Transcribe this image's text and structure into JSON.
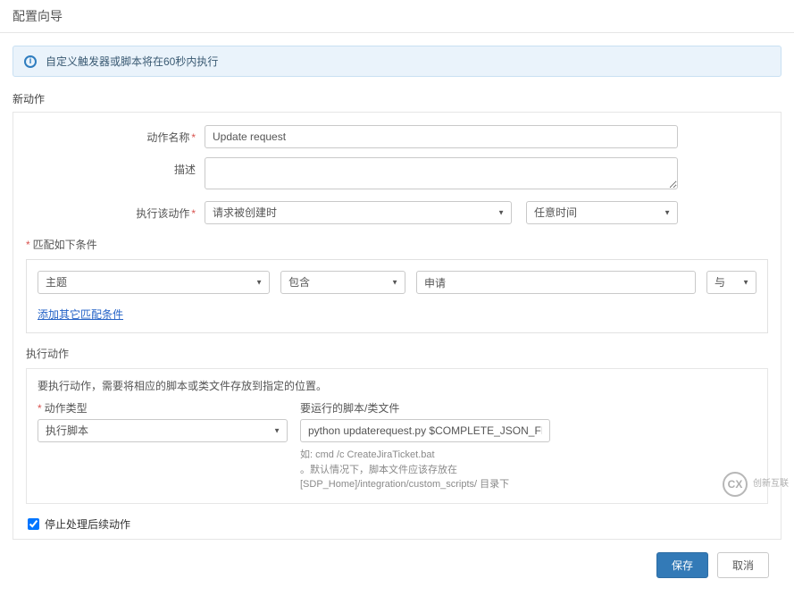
{
  "header": {
    "title": "配置向导"
  },
  "banner": {
    "text": "自定义触发器或脚本将在60秒内执行"
  },
  "section": {
    "new_action": "新动作"
  },
  "form": {
    "action_name_label": "动作名称",
    "action_name_value": "Update request",
    "description_label": "描述",
    "description_value": "",
    "execute_label": "执行该动作",
    "execute_when_value": "请求被创建时",
    "execute_time_value": "任意时间"
  },
  "criteria": {
    "title": "匹配如下条件",
    "field_value": "主题",
    "operator_value": "包含",
    "value_value": "申请",
    "logic_value": "与",
    "add_link": "添加其它匹配条件"
  },
  "exec_action": {
    "title": "执行动作",
    "desc": "要执行动作，需要将相应的脚本或类文件存放到指定的位置。",
    "type_label": "动作类型",
    "type_value": "执行脚本",
    "script_label": "要运行的脚本/类文件",
    "script_value": "python updaterequest.py $COMPLETE_JSON_FILE",
    "hint_line1": "如: cmd /c CreateJiraTicket.bat",
    "hint_line2": "。默认情况下，脚本文件应该存放在[SDP_Home]/integration/custom_scripts/ 目录下"
  },
  "checkbox": {
    "stop_label": "停止处理后续动作"
  },
  "buttons": {
    "save": "保存",
    "cancel": "取消"
  },
  "watermark": {
    "brand": "创新互联"
  }
}
